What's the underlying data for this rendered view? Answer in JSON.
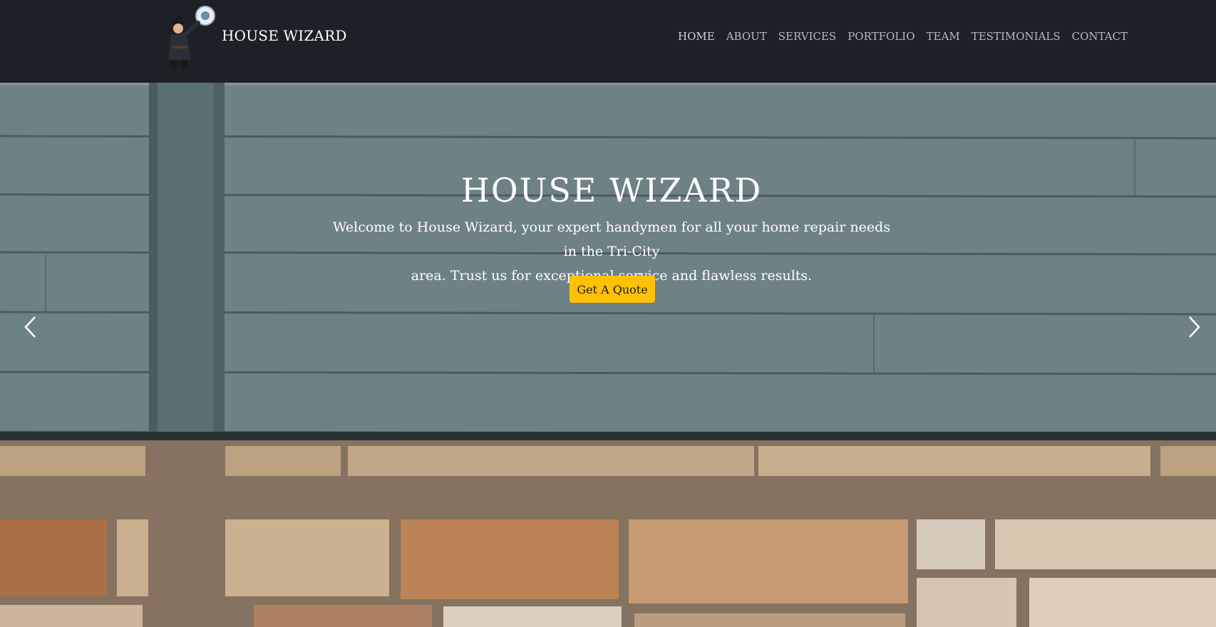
{
  "header": {
    "brand": "HOUSE WIZARD",
    "logo_icon": "wizard-mascot-icon",
    "nav": [
      {
        "label": "HOME",
        "active": true
      },
      {
        "label": "ABOUT"
      },
      {
        "label": "SERVICES"
      },
      {
        "label": "PORTFOLIO"
      },
      {
        "label": "TEAM"
      },
      {
        "label": "TESTIMONIALS"
      },
      {
        "label": "CONTACT"
      }
    ]
  },
  "hero": {
    "title": "HOUSE WIZARD",
    "text_line1": "Welcome to House Wizard, your expert handymen for all your home repair needs in the Tri-City",
    "text_line2": "area. Trust us for exceptional service and flawless results.",
    "cta_label": "Get A Quote",
    "prev_icon": "chevron-left-icon",
    "next_icon": "chevron-right-icon"
  },
  "colors": {
    "header_bg": "#1d2026",
    "siding": "#738a8e",
    "stone": "#d7b894",
    "cta": "#ffc107"
  }
}
